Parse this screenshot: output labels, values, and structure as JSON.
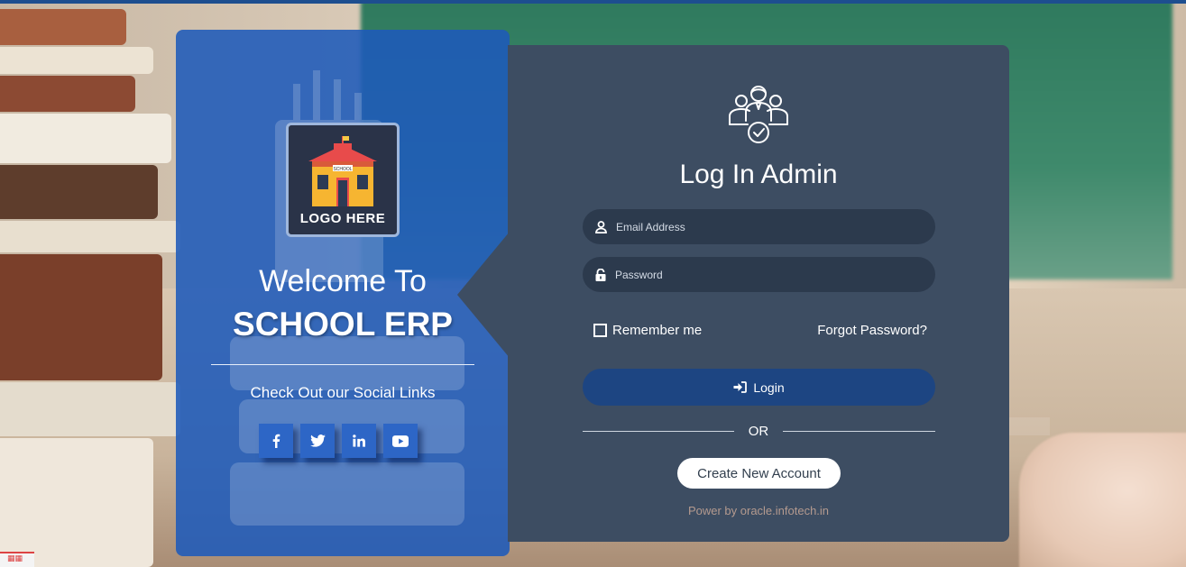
{
  "colors": {
    "accent_blue": "#1e5ab9",
    "card_bg": "#3d4d62",
    "field_bg": "#2c3a4d",
    "login_button": "#1d4582",
    "top_bar": "#1d4e8f"
  },
  "brand": {
    "logo_text": "LOGO HERE",
    "logo_sign": "SCHOOL",
    "welcome_line": "Welcome To",
    "app_name": "SCHOOL ERP",
    "social_title": "Check Out our Social Links",
    "social_links": [
      {
        "icon": "facebook-icon"
      },
      {
        "icon": "twitter-icon"
      },
      {
        "icon": "linkedin-icon"
      },
      {
        "icon": "youtube-icon"
      }
    ]
  },
  "login": {
    "header_icon": "admin-group-icon",
    "title": "Log In Admin",
    "email_placeholder": "Email Address",
    "password_placeholder": "Password",
    "remember_label": "Remember me",
    "forgot_label": "Forgot Password?",
    "login_label": "Login",
    "or_label": "OR",
    "create_label": "Create New Account",
    "powered_text": "Power by oracle.infotech.in"
  }
}
